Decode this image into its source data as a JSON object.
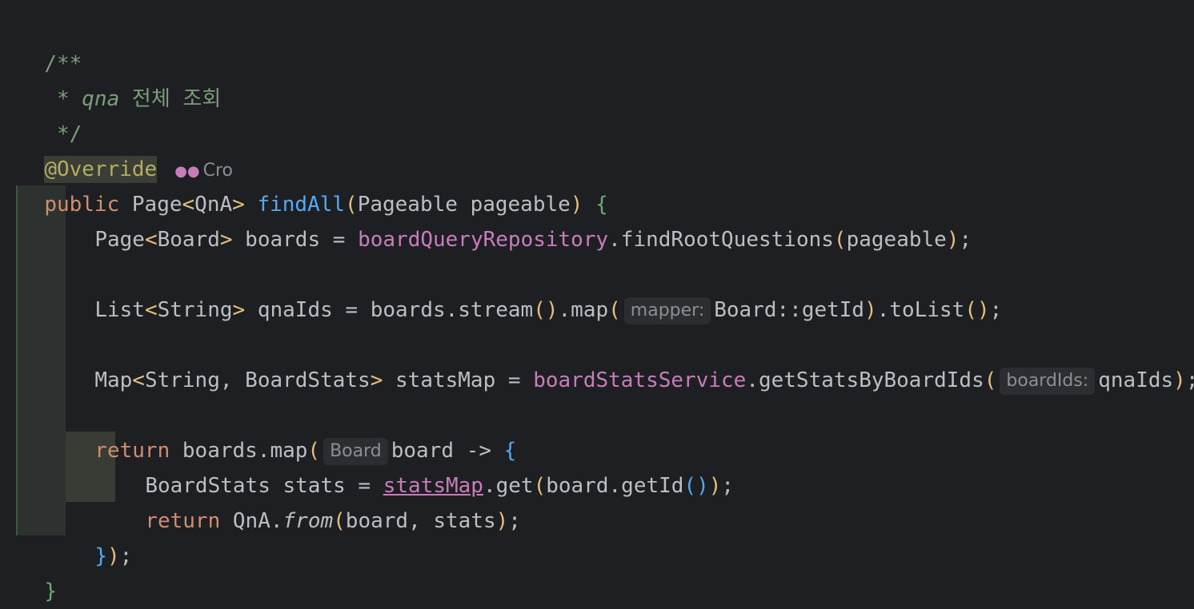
{
  "comment": {
    "open": "/**",
    "star": " * ",
    "text": "qna",
    "text_korean": " 전체 조회",
    "close": " */"
  },
  "annotation": "@Override",
  "author_hint": "Cro",
  "code": {
    "signature": {
      "kw_public": "public",
      "ret_type": " Page",
      "lt": "<",
      "generic": "QnA",
      "gt": ">",
      "method": " findAll",
      "lp": "(",
      "params": "Pageable pageable",
      "rp": ")",
      "lb": " {"
    },
    "line1": {
      "type": "Page",
      "lt": "<",
      "generic": "Board",
      "gt": ">",
      "rest": " boards = ",
      "field": "boardQueryRepository",
      "call": ".findRootQuestions",
      "lp": "(",
      "arg": "pageable",
      "rp": ")",
      "end": ";"
    },
    "line2": {
      "type": "List",
      "lt": "<",
      "generic": "String",
      "gt": ">",
      "rest": " qnaIds = boards.stream",
      "p1": "()",
      "map": ".map",
      "lp": "(",
      "hint": "mapper:",
      "arg": "Board::getId",
      "rp": ")",
      "tolist": ".toList",
      "p2": "()",
      "end": ";"
    },
    "line3": {
      "type": "Map",
      "lt": "<",
      "generic": "String, BoardStats",
      "gt": ">",
      "rest": " statsMap = ",
      "field": "boardStatsService",
      "call": ".getStatsByBoardIds",
      "lp": "(",
      "hint": "boardIds:",
      "arg": "qnaIds",
      "rp": ")",
      "end": ";"
    },
    "line4": {
      "kw": "return",
      "rest": " boards.map",
      "lp": "(",
      "hint": "Board",
      "arg": "board -> ",
      "lb": "{"
    },
    "line5": {
      "text": "BoardStats stats = ",
      "field": "statsMap",
      "call": ".get",
      "lp": "(",
      "arg": "board.getId",
      "p": "()",
      "rp": ")",
      "end": ";"
    },
    "line6": {
      "kw": "return",
      "rest": " QnA.",
      "static": "from",
      "lp": "(",
      "arg": "board, stats",
      "rp": ")",
      "end": ";"
    },
    "line7": {
      "rb": "}",
      "rp": ")",
      "end": ";"
    },
    "closing": "}"
  }
}
